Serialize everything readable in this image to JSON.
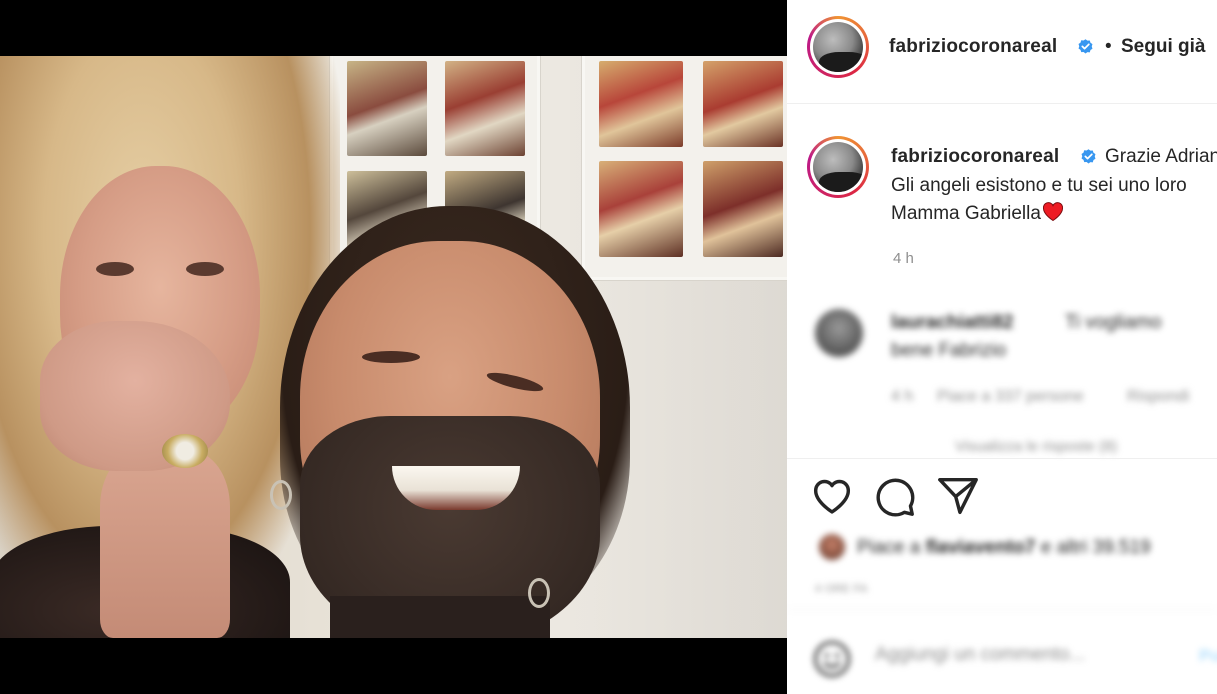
{
  "post": {
    "author": "fabriziocoronareal",
    "follow_label": "Segui già",
    "caption_line1": "Grazie Adriana",
    "caption_line2": "Gli angeli esistono e tu sei uno loro",
    "caption_line3": "Mamma Gabriella",
    "heart_emoji": "❤️",
    "time": "4 h"
  },
  "comments": [
    {
      "user": "laurachiatti82",
      "text_line1": "Ti vogliamo",
      "text_line2": "bene Fabrizio",
      "time": "4 h",
      "likes": "Piace a 337 persone",
      "reply_label": "Rispondi",
      "view_replies": "Visualizza le risposte (8)"
    }
  ],
  "actions": {
    "likes_prefix": "Piace a ",
    "likes_user": "flaviavento7",
    "likes_suffix": " e altri 39.519",
    "date": "4 ORE FA"
  },
  "comment_box": {
    "placeholder": "Aggiungi un commento...",
    "publish_label": "Pubblica"
  },
  "colors": {
    "verified_blue": "#3897f0",
    "text": "#262626",
    "muted": "#8e8e8e",
    "heart_red": "#ed1c24"
  }
}
